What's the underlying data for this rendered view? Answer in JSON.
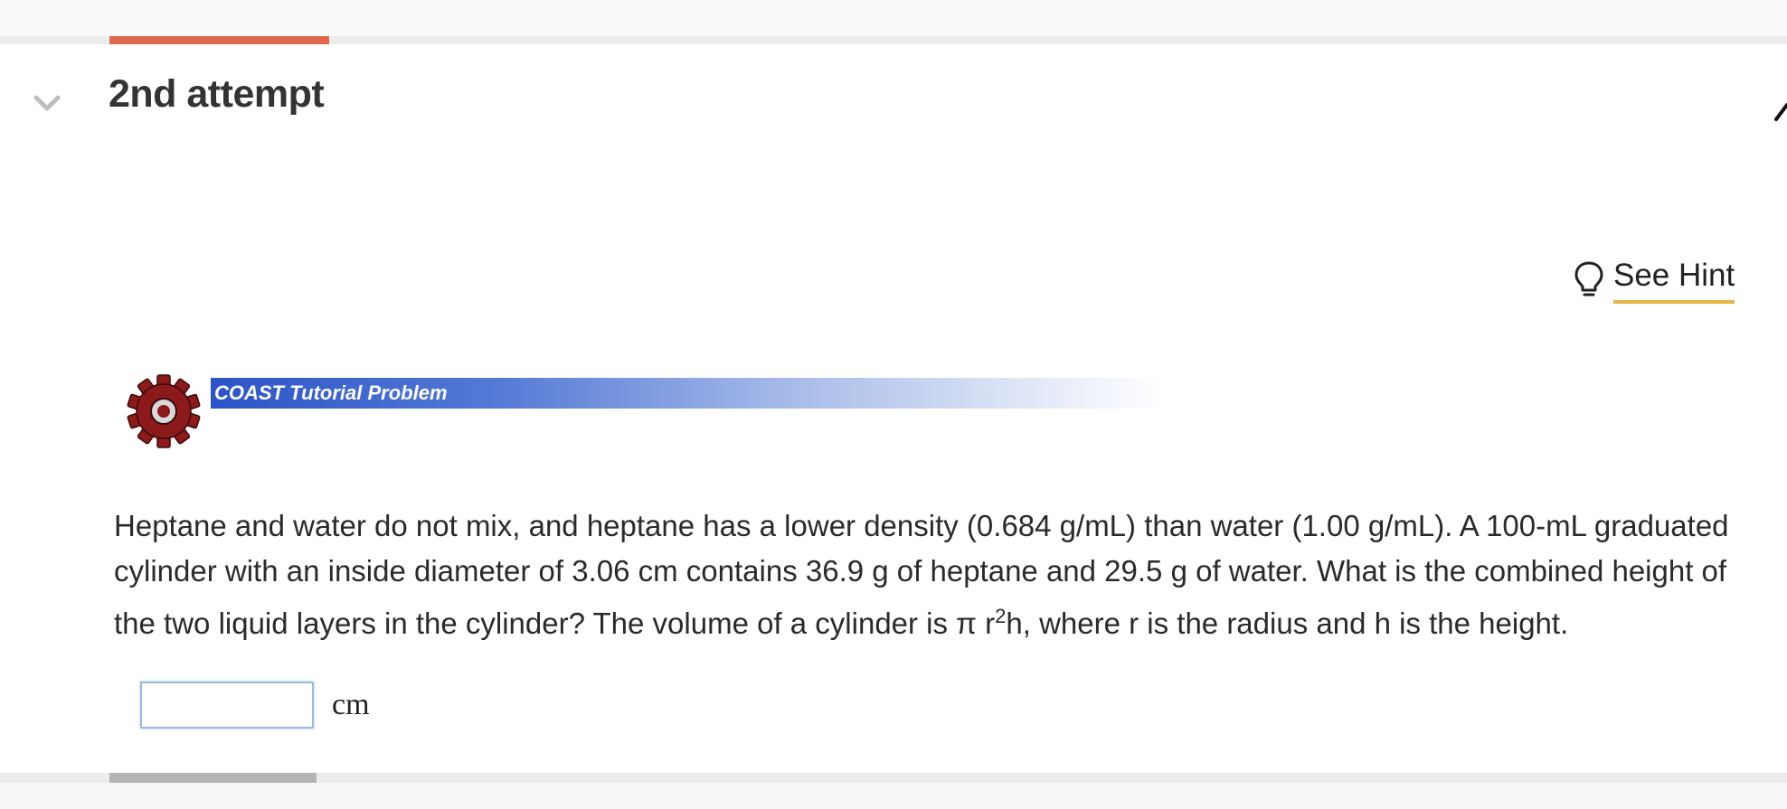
{
  "attempt": {
    "title": "2nd attempt",
    "progress_fraction": 0.12
  },
  "hint": {
    "label": "See Hint",
    "icon": "lightbulb-icon"
  },
  "banner": {
    "label": "COAST Tutorial Problem",
    "icon": "gear-icon",
    "colors": {
      "bar_start": "#2b55c7",
      "gear": "#8c1a1a"
    }
  },
  "problem": {
    "text_line1": "Heptane and water do not mix, and heptane has a lower density (0.684 g/mL) than water (1.00 g/mL). A 100-mL graduated cylinder with an inside diameter of  3.06  cm contains 36.9  g of heptane and 29.5 g of water. What is the combined height of the two liquid layers in the cylinder?  The volume of a cylinder is π r",
    "superscript": "2",
    "text_line2": "h, where r is the radius and h is the height."
  },
  "answer": {
    "value": "",
    "placeholder": "",
    "unit": "cm"
  },
  "colors": {
    "accent": "#e0684b",
    "hint_underline": "#e3b647",
    "input_border": "#9ab8e0"
  }
}
